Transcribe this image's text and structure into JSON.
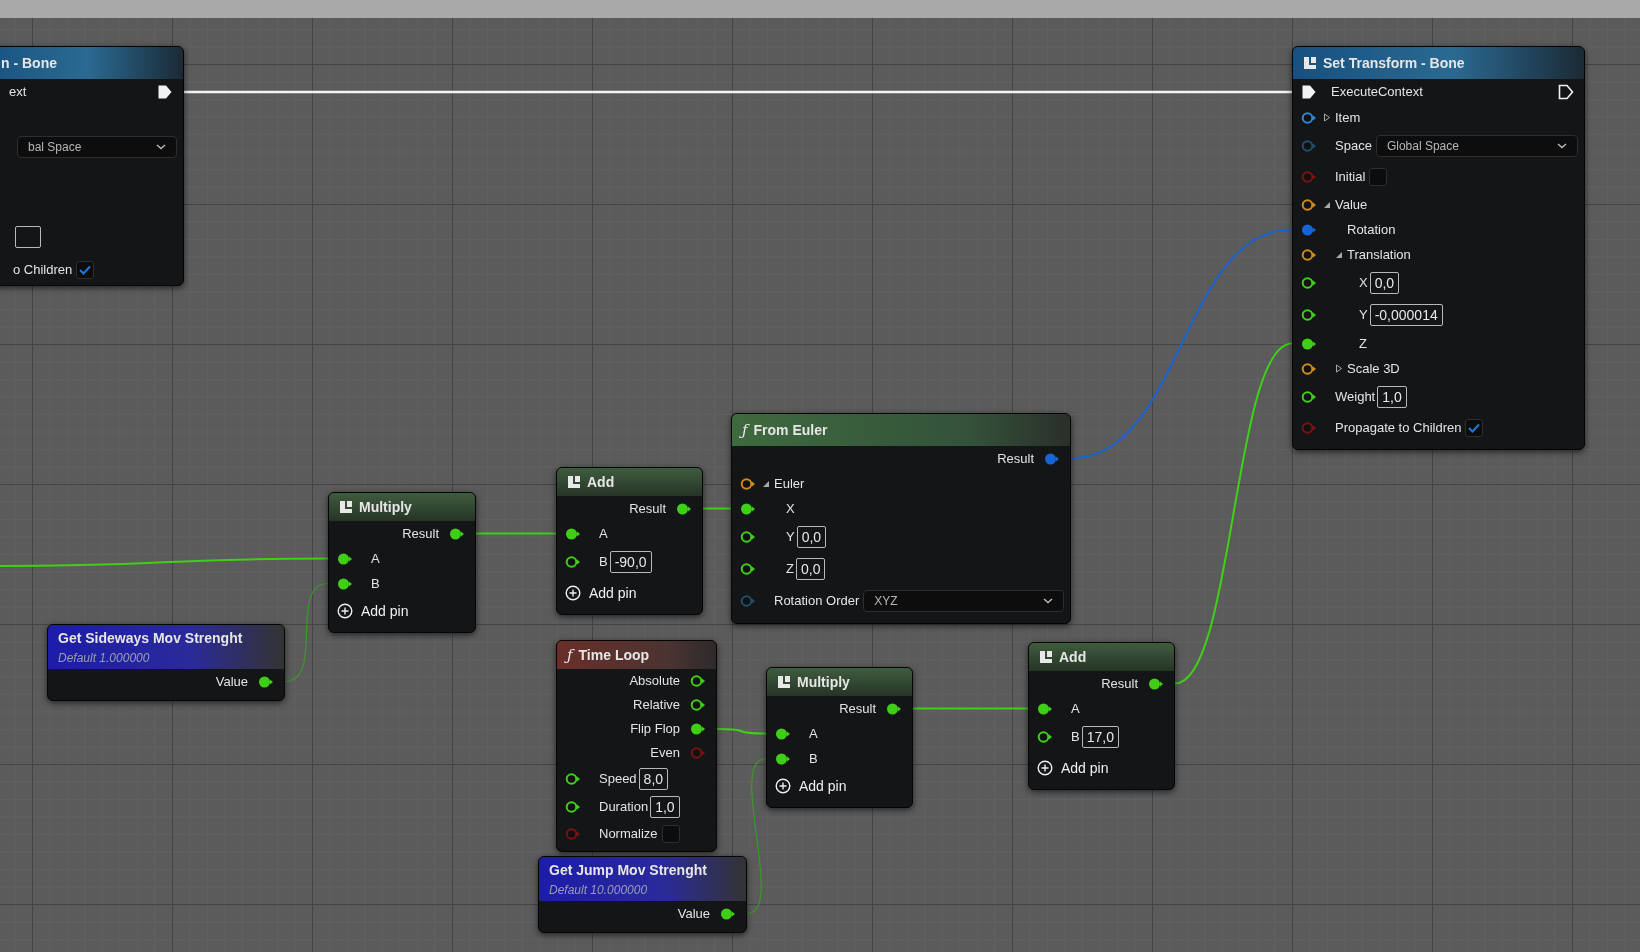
{
  "nodes": [
    {
      "kind": "mutable",
      "title": "n - Bone",
      "rows": [
        {
          "kind": "exec",
          "label": "ext",
          "out_connected": true
        },
        {
          "kind": "in",
          "control": {
            "kind": "dropdown",
            "option": "bal Space"
          }
        },
        {
          "kind": "in",
          "control": {
            "kind": "number"
          }
        },
        {
          "kind": "in",
          "label": "o Children",
          "control": {
            "kind": "checkbox",
            "checked": true
          }
        }
      ]
    },
    {
      "kind": "mutable",
      "title": "Set Transform - Bone",
      "rows": [
        {
          "kind": "exec",
          "label": "ExecuteContext",
          "in_connected": true,
          "out_connected": false
        },
        {
          "kind": "in",
          "label": "Item",
          "color": "#2f86d8",
          "connected": false,
          "expanded": false
        },
        {
          "kind": "in",
          "label": "Space",
          "color": "#1d4e6e",
          "connected": false,
          "control": {
            "kind": "dropdown",
            "option": "Global Space"
          }
        },
        {
          "kind": "in",
          "label": "Initial",
          "color": "#7a1212",
          "connected": false,
          "control": {
            "kind": "checkbox",
            "checked": false
          }
        },
        {
          "kind": "in",
          "label": "Value",
          "color": "#d08a1a",
          "connected": false,
          "expanded": true,
          "children": [
            {
              "kind": "in",
              "label": "Rotation",
              "color": "#1565d8",
              "connected": true
            },
            {
              "kind": "in",
              "label": "Translation",
              "color": "#d08a1a",
              "connected": false,
              "expanded": true,
              "children": [
                {
                  "kind": "in",
                  "label": "X",
                  "color": "#3fcf16",
                  "connected": false,
                  "control": {
                    "kind": "number",
                    "value": "0,0"
                  }
                },
                {
                  "kind": "in",
                  "label": "Y",
                  "color": "#3fcf16",
                  "connected": false,
                  "control": {
                    "kind": "number",
                    "value": "-0,000014"
                  }
                },
                {
                  "kind": "in",
                  "label": "Z",
                  "color": "#3fcf16",
                  "connected": true
                }
              ]
            },
            {
              "kind": "in",
              "label": "Scale 3D",
              "color": "#d08a1a",
              "connected": false,
              "expanded": false
            }
          ]
        },
        {
          "kind": "in",
          "label": "Weight",
          "color": "#3fcf16",
          "connected": false,
          "control": {
            "kind": "number",
            "value": "1,0"
          }
        },
        {
          "kind": "in",
          "label": "Propagate to Children",
          "color": "#7a1212",
          "connected": false,
          "control": {
            "kind": "checkbox",
            "checked": true
          }
        }
      ]
    },
    {
      "kind": "operator",
      "title": "Multiply",
      "rows": [
        {
          "kind": "out",
          "label": "Result",
          "color": "#3fcf16",
          "connected": true
        },
        {
          "kind": "in",
          "label": "A",
          "color": "#3fcf16",
          "connected": true
        },
        {
          "kind": "in",
          "label": "B",
          "color": "#3fcf16",
          "connected": true
        },
        {
          "kind": "add_pin",
          "label": "Add pin"
        }
      ]
    },
    {
      "kind": "operator",
      "title": "Add",
      "rows": [
        {
          "kind": "out",
          "label": "Result",
          "color": "#3fcf16",
          "connected": true
        },
        {
          "kind": "in",
          "label": "A",
          "color": "#3fcf16",
          "connected": true
        },
        {
          "kind": "in",
          "label": "B",
          "color": "#3fcf16",
          "connected": false,
          "control": {
            "kind": "number",
            "value": "-90,0"
          }
        },
        {
          "kind": "add_pin",
          "label": "Add pin"
        }
      ]
    },
    {
      "kind": "pure_function",
      "icon": "ƒ",
      "title": "From Euler",
      "rows": [
        {
          "kind": "out",
          "label": "Result",
          "color": "#1565d8",
          "connected": true
        },
        {
          "kind": "in",
          "label": "Euler",
          "color": "#d08a1a",
          "connected": false,
          "expanded": true,
          "children": [
            {
              "kind": "in",
              "label": "X",
              "color": "#3fcf16",
              "connected": true
            },
            {
              "kind": "in",
              "label": "Y",
              "color": "#3fcf16",
              "connected": false,
              "control": {
                "kind": "number",
                "value": "0,0"
              }
            },
            {
              "kind": "in",
              "label": "Z",
              "color": "#3fcf16",
              "connected": false,
              "control": {
                "kind": "number",
                "value": "0,0"
              }
            }
          ]
        },
        {
          "kind": "in",
          "label": "Rotation Order",
          "color": "#1d4e6e",
          "connected": false,
          "control": {
            "kind": "dropdown",
            "option": "XYZ"
          }
        }
      ]
    },
    {
      "kind": "variable",
      "title": "Get Sideways Mov Strenght",
      "subtitle": "Default 1.000000",
      "rows": [
        {
          "kind": "out",
          "label": "Value",
          "color": "#3fcf16",
          "connected": true
        }
      ]
    },
    {
      "kind": "impure_function",
      "icon": "ƒ",
      "title": "Time Loop",
      "rows": [
        {
          "kind": "out",
          "label": "Absolute",
          "color": "#3fcf16",
          "connected": false
        },
        {
          "kind": "out",
          "label": "Relative",
          "color": "#3fcf16",
          "connected": false
        },
        {
          "kind": "out",
          "label": "Flip Flop",
          "color": "#3fcf16",
          "connected": true
        },
        {
          "kind": "out",
          "label": "Even",
          "color": "#7a1212",
          "connected": false
        },
        {
          "kind": "in",
          "label": "Speed",
          "color": "#3fcf16",
          "connected": false,
          "control": {
            "kind": "number",
            "value": "8,0"
          }
        },
        {
          "kind": "in",
          "label": "Duration",
          "color": "#3fcf16",
          "connected": false,
          "control": {
            "kind": "number",
            "value": "1,0"
          }
        },
        {
          "kind": "in",
          "label": "Normalize",
          "color": "#7a1212",
          "connected": false,
          "control": {
            "kind": "checkbox",
            "checked": false
          }
        }
      ]
    },
    {
      "kind": "operator",
      "title": "Multiply",
      "rows": [
        {
          "kind": "out",
          "label": "Result",
          "color": "#3fcf16",
          "connected": true
        },
        {
          "kind": "in",
          "label": "A",
          "color": "#3fcf16",
          "connected": true
        },
        {
          "kind": "in",
          "label": "B",
          "color": "#3fcf16",
          "connected": true
        },
        {
          "kind": "add_pin",
          "label": "Add pin"
        }
      ]
    },
    {
      "kind": "operator",
      "title": "Add",
      "rows": [
        {
          "kind": "out",
          "label": "Result",
          "color": "#3fcf16",
          "connected": true
        },
        {
          "kind": "in",
          "label": "A",
          "color": "#3fcf16",
          "connected": true
        },
        {
          "kind": "in",
          "label": "B",
          "color": "#3fcf16",
          "connected": false,
          "control": {
            "kind": "number",
            "value": "17,0"
          }
        },
        {
          "kind": "add_pin",
          "label": "Add pin"
        }
      ]
    },
    {
      "kind": "variable",
      "title": "Get Jump Mov Strenght",
      "subtitle": "Default 10.000000",
      "rows": [
        {
          "kind": "out",
          "label": "Value",
          "color": "#3fcf16",
          "connected": true
        }
      ]
    }
  ]
}
